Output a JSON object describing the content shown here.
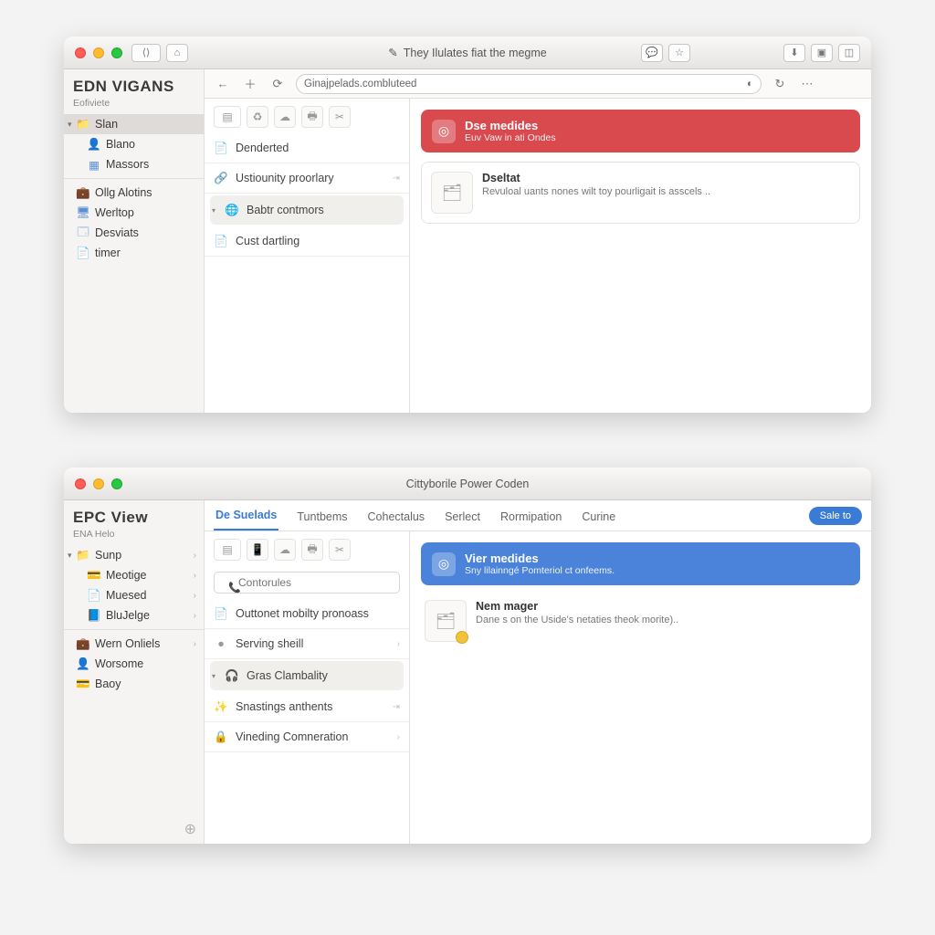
{
  "win1": {
    "titlebar_text": "They Ilulates fiat the megme",
    "url": "Ginajpelads.combluteed",
    "sidebar": {
      "heading": "EDN VIGANS",
      "sub": "Eofiviete",
      "items": [
        {
          "label": "Slan",
          "icon": "folder",
          "parent": true,
          "sel": true
        },
        {
          "label": "Blano",
          "icon": "user",
          "child": true
        },
        {
          "label": "Massors",
          "icon": "grid",
          "child": true
        },
        {
          "label": "Ollg Alotins",
          "icon": "briefcase"
        },
        {
          "label": "Werltop",
          "icon": "monitor"
        },
        {
          "label": "Desviats",
          "icon": "window"
        },
        {
          "label": "timer",
          "icon": "doc"
        }
      ]
    },
    "mid": {
      "items": [
        {
          "label": "Denderted",
          "icon": "doc"
        },
        {
          "label": "Ustiounity proorlary",
          "icon": "link",
          "arrow": true
        },
        {
          "label": "Babtr contmors",
          "icon": "globe",
          "sel": true,
          "parent": true
        },
        {
          "label": "Cust dartling",
          "icon": "doc"
        }
      ]
    },
    "banner": {
      "title": "Dse medides",
      "sub": "Euv Vaw in ati Ondes"
    },
    "card": {
      "title": "Dseltat",
      "desc": "Revuloal uants nones wilt toy pourligait is asscels .."
    }
  },
  "win2": {
    "titlebar_text": "Cittyborile Power Coden",
    "tabs": [
      "De Suelads",
      "Tuntbems",
      "Cohectalus",
      "Serlect",
      "Rormipation",
      "Curine"
    ],
    "action_btn": "Sale to",
    "sidebar": {
      "heading": "EPC View",
      "sub": "ENA Helo",
      "groupA": [
        {
          "label": "Sunp",
          "icon": "folder",
          "parent": true
        },
        {
          "label": "Meotige",
          "icon": "card",
          "child": true
        },
        {
          "label": "Muesed",
          "icon": "doc",
          "child": true
        },
        {
          "label": "BluJelge",
          "icon": "doc",
          "child": true
        }
      ],
      "groupB": [
        {
          "label": "Wern Onliels",
          "icon": "briefcase"
        },
        {
          "label": "Worsome",
          "icon": "user"
        },
        {
          "label": "Baoy",
          "icon": "card"
        }
      ]
    },
    "mid": {
      "search_placeholder": "Contorules",
      "items": [
        {
          "label": "Outtonet mobilty pronoass",
          "icon": "doc"
        },
        {
          "label": "Serving sheill",
          "icon": "dot-red",
          "arrow": true
        },
        {
          "label": "Gras Clambality",
          "icon": "headset",
          "sel": true,
          "parent": true
        },
        {
          "label": "Snastings anthents",
          "icon": "sparkle",
          "arrow": true
        },
        {
          "label": "Vineding Comneration",
          "icon": "lock",
          "arrow": true
        }
      ]
    },
    "banner": {
      "title": "Vier medides",
      "sub": "Sny lilainngé Pomteriol ct onfeems."
    },
    "card": {
      "title": "Nem mager",
      "desc": "Dane s on the Uside's netaties theok morite).."
    }
  }
}
